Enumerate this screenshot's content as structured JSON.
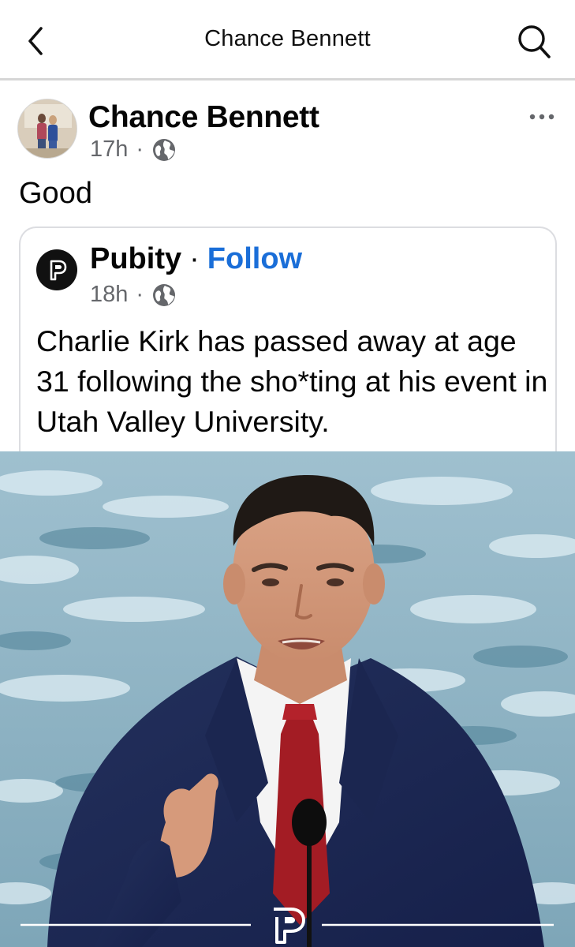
{
  "navbar": {
    "title": "Chance Bennett",
    "back_icon": "chevron-left-icon",
    "search_icon": "search-icon"
  },
  "post": {
    "author": "Chance Bennett",
    "time": "17h",
    "separator": "·",
    "audience_icon": "globe-icon",
    "more_icon": "more-horizontal-icon",
    "text": "Good"
  },
  "shared": {
    "page_name": "Pubity",
    "separator": "·",
    "follow_label": "Follow",
    "time": "18h",
    "audience_icon": "globe-icon",
    "text": "Charlie Kirk has passed away at age 31 following the sho*ting at his event in Utah Valley University."
  },
  "colors": {
    "text_primary": "#050505",
    "text_secondary": "#65676b",
    "link_blue": "#1a6ed8",
    "divider": "#d6d6d6",
    "card_border": "#dcdde1"
  }
}
